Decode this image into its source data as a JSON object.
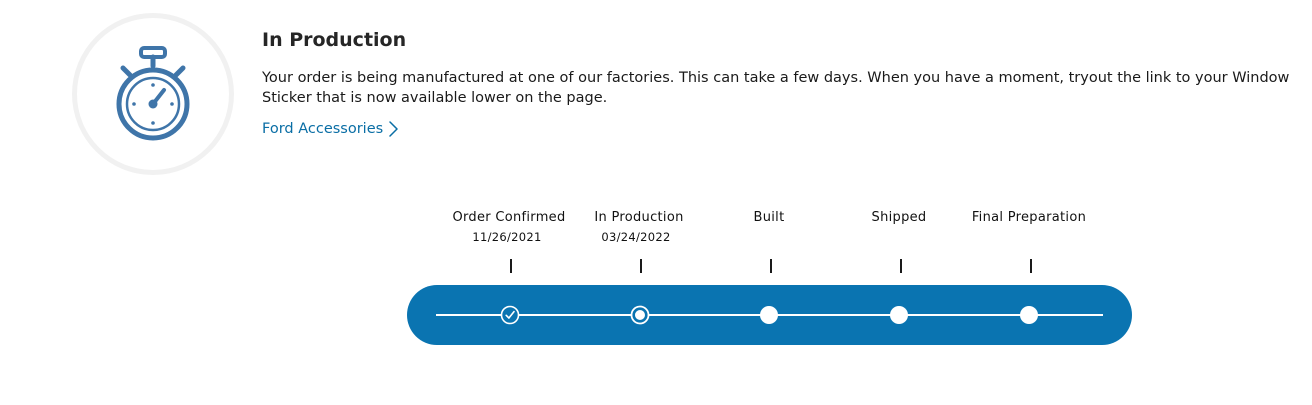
{
  "icon": {
    "name": "stopwatch-icon",
    "color": "#3f75a9"
  },
  "status": {
    "title": "In Production",
    "description": "Your order is being manufactured at one of our factories. This can take a few days. When you have a moment, tryout the link to your Window Sticker that is now available lower on the page.",
    "link_label": "Ford Accessories",
    "link_icon": "chevron-right-icon"
  },
  "tracker": {
    "bar_color": "#0a74b1",
    "steps": [
      {
        "label": "Order Confirmed",
        "date": "11/26/2021",
        "state": "completed",
        "icon": "check-circle-icon"
      },
      {
        "label": "In Production",
        "date": "03/24/2022",
        "state": "current",
        "icon": "current-step-icon"
      },
      {
        "label": "Built",
        "date": "",
        "state": "pending",
        "icon": "pending-dot-icon"
      },
      {
        "label": "Shipped",
        "date": "",
        "state": "pending",
        "icon": "pending-dot-icon"
      },
      {
        "label": "Final Preparation",
        "date": "",
        "state": "pending",
        "icon": "pending-dot-icon"
      }
    ]
  }
}
